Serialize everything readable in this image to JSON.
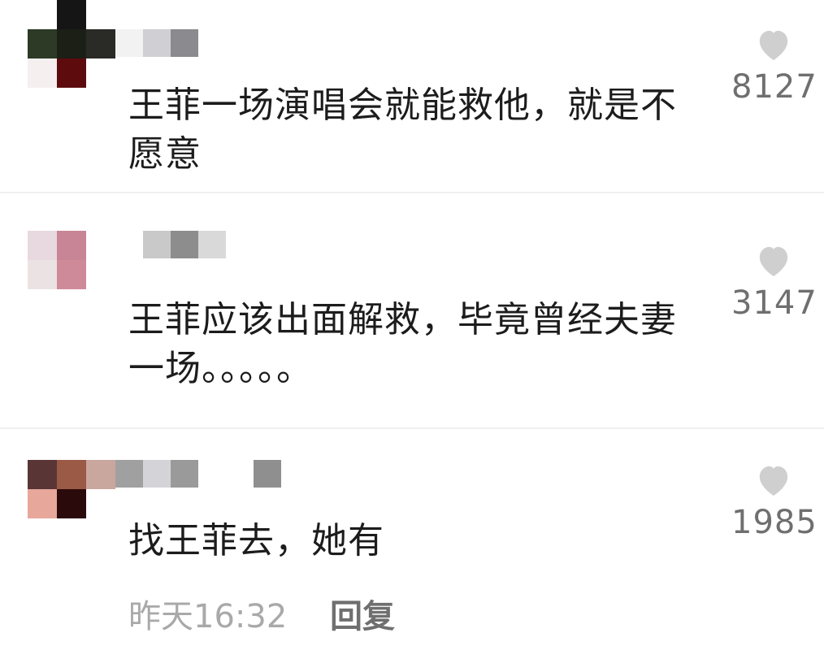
{
  "comments": [
    {
      "text": "王菲一场演唱会就能救他，就是不愿意",
      "likes": "8127",
      "avatar_pixels": [
        "#ffffff",
        "#151515",
        "#ffffff",
        "#2c3a26",
        "#1b1f16",
        "#2a2a26",
        "#f5efef",
        "#5e0b0e",
        "#ffffff"
      ],
      "name_pixels": [
        "#f2f2f2",
        "#cfcfd4",
        "#8a8a8f",
        "#ffffff",
        "#ffffff",
        "#ffffff",
        "#ffffff",
        "#ffffff",
        "#ffffff",
        "#ffffff",
        "#ffffff",
        "#ffffff"
      ]
    },
    {
      "text": "王菲应该出面解救，毕竟曾经夫妻一场。。。。。",
      "likes": "3147",
      "avatar_pixels": [
        "#ffffff",
        "#ffffff",
        "#ffffff",
        "#e8d8e0",
        "#c78595",
        "#ffffff",
        "#ebe3e3",
        "#cf8a99",
        "#ffffff"
      ],
      "name_pixels": [
        "#ffffff",
        "#ffffff",
        "#c9c9c9",
        "#8d8d8d",
        "#d9d9d9",
        "#ffffff",
        "#ffffff",
        "#ffffff",
        "#ffffff",
        "#ffffff",
        "#ffffff",
        "#ffffff"
      ]
    },
    {
      "text": "找王菲去，她有",
      "likes": "1985",
      "avatar_pixels": [
        "#ffffff",
        "#ffffff",
        "#ffffff",
        "#5a3536",
        "#9a5a45",
        "#c9a79f",
        "#e7a79b",
        "#2a0a0a",
        "#ffffff"
      ],
      "name_pixels": [
        "#a0a0a0",
        "#d4d4d8",
        "#9a9a9a",
        "#ffffff",
        "#ffffff",
        "#8f8f8f",
        "#ffffff",
        "#ffffff",
        "#ffffff",
        "#ffffff",
        "#ffffff",
        "#ffffff"
      ]
    }
  ],
  "meta": {
    "time": "昨天16:32",
    "reply": "回复"
  },
  "colors": {
    "heart": "#cfcfcf",
    "count": "#6f6f6f",
    "text": "#1c1c1c"
  },
  "icons": {
    "like": "heart-icon"
  }
}
